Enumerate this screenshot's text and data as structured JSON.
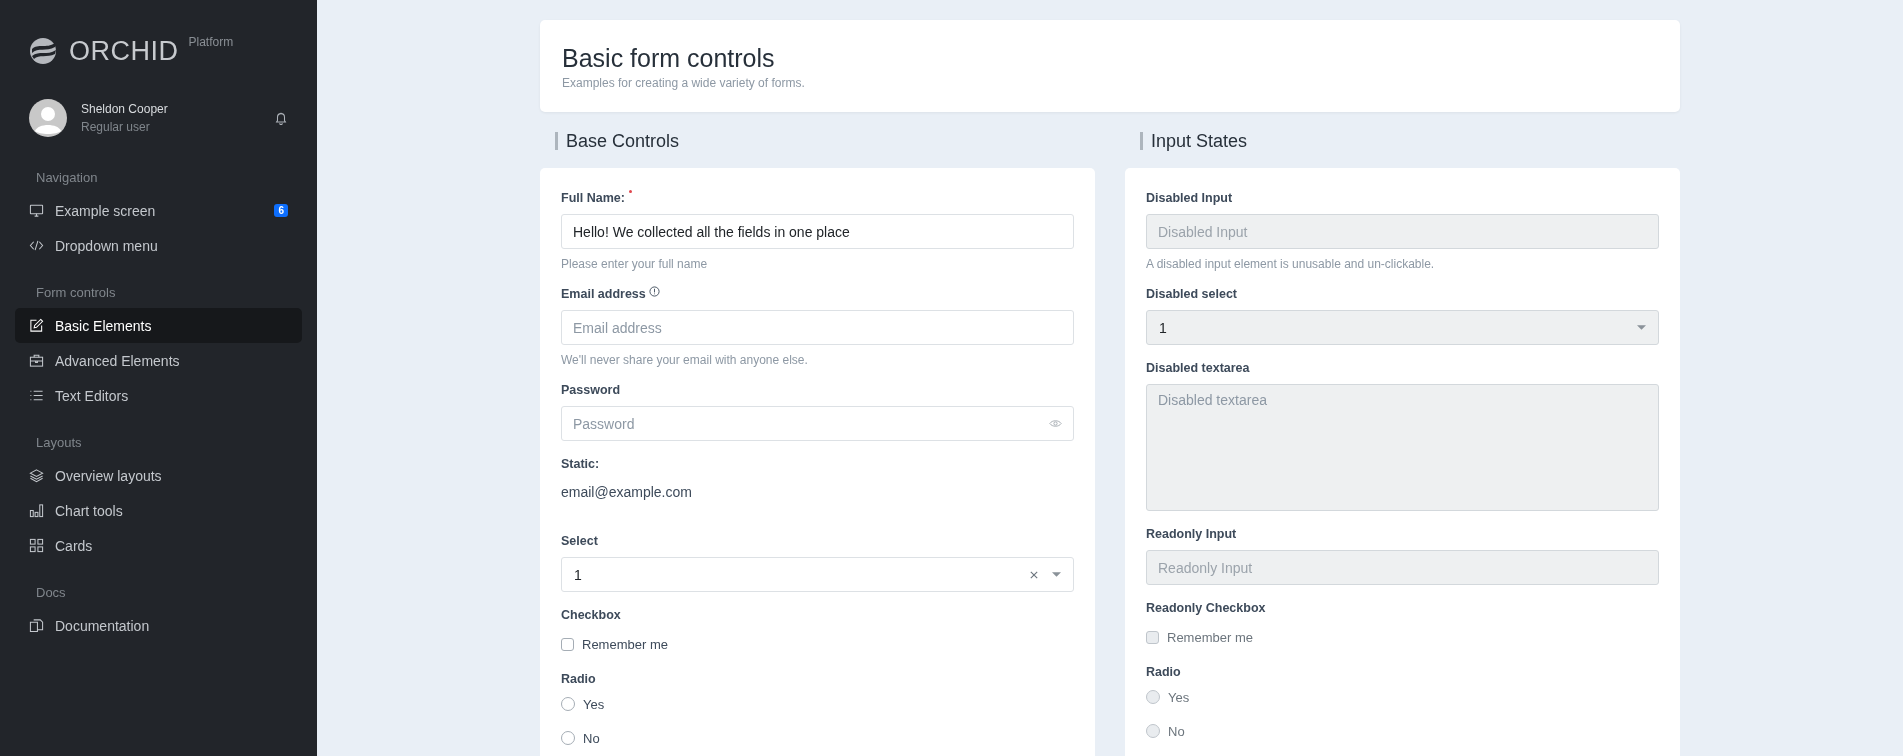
{
  "sidebar": {
    "brand": "ORCHID",
    "brand_suffix": "Platform",
    "user": {
      "name": "Sheldon Cooper",
      "role": "Regular user"
    },
    "sections": [
      {
        "title": "Navigation",
        "items": [
          {
            "label": "Example screen",
            "badge": "6",
            "selected": false
          },
          {
            "label": "Dropdown menu",
            "selected": false
          }
        ]
      },
      {
        "title": "Form controls",
        "items": [
          {
            "label": "Basic Elements",
            "selected": true
          },
          {
            "label": "Advanced Elements",
            "selected": false
          },
          {
            "label": "Text Editors",
            "selected": false
          }
        ]
      },
      {
        "title": "Layouts",
        "items": [
          {
            "label": "Overview layouts",
            "selected": false
          },
          {
            "label": "Chart tools",
            "selected": false
          },
          {
            "label": "Cards",
            "selected": false
          }
        ]
      },
      {
        "title": "Docs",
        "items": [
          {
            "label": "Documentation",
            "selected": false
          }
        ]
      }
    ]
  },
  "header": {
    "title": "Basic form controls",
    "subtitle": "Examples for creating a wide variety of forms."
  },
  "panels": [
    {
      "title": "Base Controls",
      "fields": [
        {
          "kind": "input",
          "label": "Full Name:",
          "required": true,
          "value": "Hello! We collected all the fields in one place",
          "help": "Please enter your full name",
          "disabled": false
        },
        {
          "kind": "input",
          "label": "Email address",
          "info": true,
          "placeholder": "Email address",
          "help": "We'll never share your email with anyone else.",
          "disabled": false
        },
        {
          "kind": "password",
          "label": "Password",
          "placeholder": "Password",
          "disabled": false
        },
        {
          "kind": "static",
          "label": "Static:",
          "value": "email@example.com"
        },
        {
          "kind": "select",
          "label": "Select",
          "value": "1",
          "clearable": true,
          "disabled": false
        },
        {
          "kind": "checkbox",
          "label": "Checkbox",
          "disabled": false,
          "options": [
            {
              "label": "Remember me",
              "checked": false
            }
          ]
        },
        {
          "kind": "radio",
          "label": "Radio",
          "disabled": false,
          "options": [
            {
              "label": "Yes",
              "selected": false
            },
            {
              "label": "No",
              "selected": false
            }
          ]
        }
      ]
    },
    {
      "title": "Input States",
      "fields": [
        {
          "kind": "input",
          "label": "Disabled Input",
          "placeholder": "Disabled Input",
          "help": "A disabled input element is unusable and un-clickable.",
          "disabled": true
        },
        {
          "kind": "select",
          "label": "Disabled select",
          "value": "1",
          "clearable": false,
          "disabled": true
        },
        {
          "kind": "textarea",
          "label": "Disabled textarea",
          "placeholder": "Disabled textarea",
          "disabled": true
        },
        {
          "kind": "input",
          "label": "Readonly Input",
          "placeholder": "Readonly Input",
          "disabled": true
        },
        {
          "kind": "checkbox",
          "label": "Readonly Checkbox",
          "disabled": true,
          "options": [
            {
              "label": "Remember me",
              "checked": false
            }
          ]
        },
        {
          "kind": "radio",
          "label": "Radio",
          "disabled": true,
          "options": [
            {
              "label": "Yes",
              "selected": false
            },
            {
              "label": "No",
              "selected": false
            }
          ]
        }
      ]
    }
  ]
}
